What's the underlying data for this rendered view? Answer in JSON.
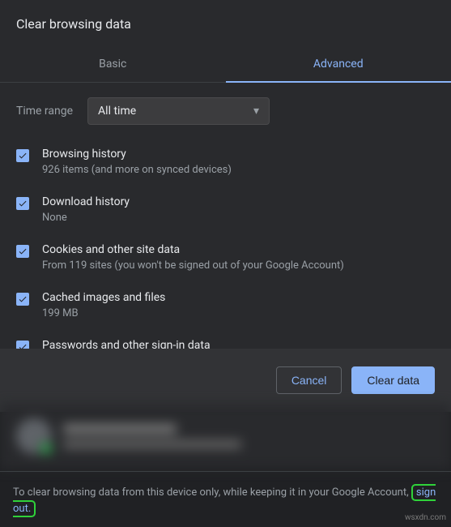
{
  "title": "Clear browsing data",
  "tabs": {
    "basic": "Basic",
    "advanced": "Advanced"
  },
  "time": {
    "label": "Time range",
    "value": "All time"
  },
  "options": [
    {
      "title": "Browsing history",
      "sub": "926 items (and more on synced devices)"
    },
    {
      "title": "Download history",
      "sub": "None"
    },
    {
      "title": "Cookies and other site data",
      "sub": "From 119 sites (you won't be signed out of your Google Account)"
    },
    {
      "title": "Cached images and files",
      "sub": "199 MB"
    },
    {
      "title": "Passwords and other sign-in data",
      "sub": ""
    }
  ],
  "actions": {
    "cancel": "Cancel",
    "clear": "Clear data"
  },
  "footer": {
    "prefix": "To clear browsing data from this device only, while keeping it in your Google Account, ",
    "signout": "sign out."
  },
  "watermark": "wsxdn.com"
}
